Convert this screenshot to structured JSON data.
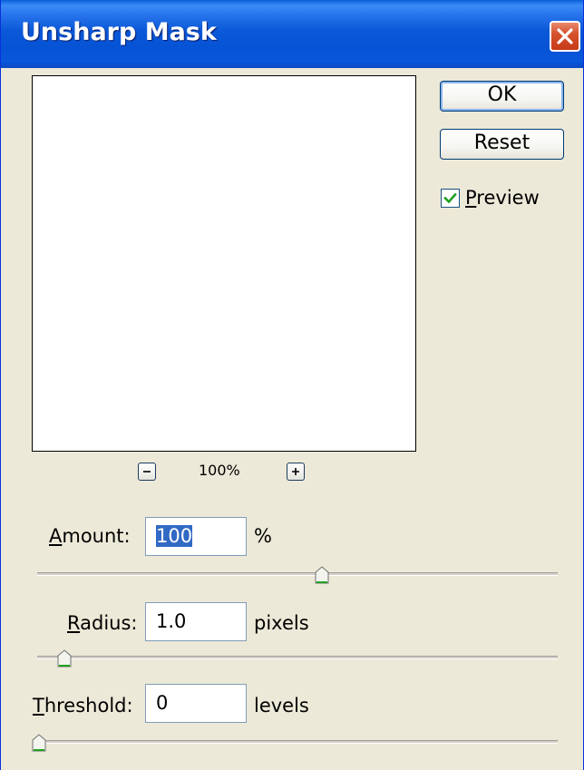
{
  "window": {
    "title": "Unsharp Mask"
  },
  "buttons": {
    "ok_label": "OK",
    "reset_label": "Reset"
  },
  "preview": {
    "label_first": "P",
    "label_rest": "review",
    "checked": true
  },
  "zoom": {
    "level": "100%"
  },
  "amount": {
    "label_first": "A",
    "label_rest": "mount:",
    "value": "100",
    "unit": "%",
    "slider_fraction": 0.56
  },
  "radius": {
    "label_first": "R",
    "label_rest": "adius:",
    "value": "1.0",
    "unit": "pixels",
    "slider_fraction": 0.05
  },
  "threshold": {
    "label_first": "T",
    "label_rest": "hreshold:",
    "value": "0",
    "unit": "levels",
    "slider_fraction": 0.0
  },
  "icons": {
    "close": "close-icon",
    "checkmark": "checkmark-icon",
    "zoom_out": "minus-icon",
    "zoom_in": "plus-icon"
  },
  "colors": {
    "titlebar": "#0b58d8",
    "close_button": "#d6532f",
    "dialog_background": "#ece9d8",
    "selection": "#316ac5",
    "slider_thumb_accent": "#21a121"
  }
}
